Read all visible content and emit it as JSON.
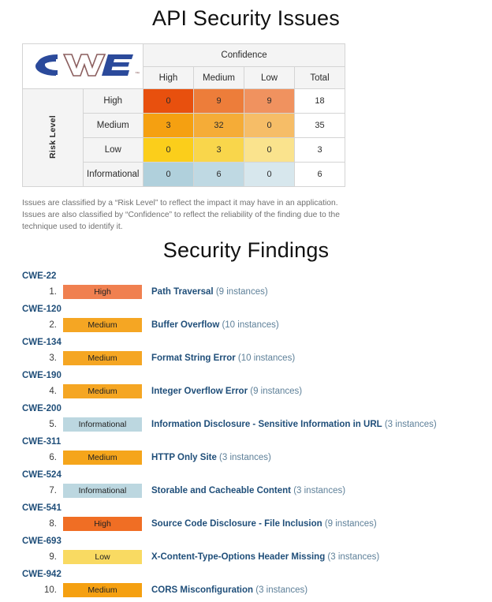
{
  "headings": {
    "api_security_issues": "API Security Issues",
    "security_findings": "Security Findings"
  },
  "logo": {
    "name": "cwe-logo",
    "text": "CWE",
    "trademark": "™",
    "blue": "#2B4A9B",
    "maroon": "#8B5E5E"
  },
  "matrix": {
    "confidence_header": "Confidence",
    "risk_level_header": "Risk Level",
    "confidence_columns": [
      "High",
      "Medium",
      "Low"
    ],
    "total_column": "Total",
    "rows": [
      {
        "risk": "High",
        "cells": [
          {
            "value": "0",
            "color": "#E8500E"
          },
          {
            "value": "9",
            "color": "#ED7D3A"
          },
          {
            "value": "9",
            "color": "#F0925F"
          }
        ],
        "total": "18"
      },
      {
        "risk": "Medium",
        "cells": [
          {
            "value": "3",
            "color": "#F5A011"
          },
          {
            "value": "32",
            "color": "#F5AC37"
          },
          {
            "value": "0",
            "color": "#F6BD67"
          }
        ],
        "total": "35"
      },
      {
        "risk": "Low",
        "cells": [
          {
            "value": "0",
            "color": "#FBCE1B"
          },
          {
            "value": "3",
            "color": "#F9D64B"
          },
          {
            "value": "0",
            "color": "#FAE38D"
          }
        ],
        "total": "3"
      },
      {
        "risk": "Informational",
        "cells": [
          {
            "value": "0",
            "color": "#B0D0DC"
          },
          {
            "value": "6",
            "color": "#BFD9E3"
          },
          {
            "value": "0",
            "color": "#D7E7ED"
          }
        ],
        "total": "6"
      }
    ]
  },
  "description": "Issues are classified by a “Risk Level” to reflect the impact it may have in an application. Issues are also classified by “Confidence” to reflect the reliability of the finding due to the technique used to identify it.",
  "findings": [
    {
      "cwe": "CWE-22",
      "number": "1.",
      "severity": "High",
      "severity_color": "#F08050",
      "name": "Path Traversal",
      "count": "(9 instances)"
    },
    {
      "cwe": "CWE-120",
      "number": "2.",
      "severity": "Medium",
      "severity_color": "#F5A623",
      "name": "Buffer Overflow",
      "count": "(10 instances)"
    },
    {
      "cwe": "CWE-134",
      "number": "3.",
      "severity": "Medium",
      "severity_color": "#F5A623",
      "name": "Format String Error",
      "count": "(10 instances)"
    },
    {
      "cwe": "CWE-190",
      "number": "4.",
      "severity": "Medium",
      "severity_color": "#F5A623",
      "name": "Integer Overflow Error",
      "count": "(9 instances)"
    },
    {
      "cwe": "CWE-200",
      "number": "5.",
      "severity": "Informational",
      "severity_color": "#BCD7E0",
      "name": "Information Disclosure - Sensitive Information in URL",
      "count": "(3 instances)"
    },
    {
      "cwe": "CWE-311",
      "number": "6.",
      "severity": "Medium",
      "severity_color": "#F5A51B",
      "name": "HTTP Only Site",
      "count": "(3 instances)"
    },
    {
      "cwe": "CWE-524",
      "number": "7.",
      "severity": "Informational",
      "severity_color": "#BCD7E0",
      "name": "Storable and Cacheable Content",
      "count": "(3 instances)"
    },
    {
      "cwe": "CWE-541",
      "number": "8.",
      "severity": "High",
      "severity_color": "#F06E24",
      "name": "Source Code Disclosure - File Inclusion",
      "count": "(9 instances)"
    },
    {
      "cwe": "CWE-693",
      "number": "9.",
      "severity": "Low",
      "severity_color": "#F9DA62",
      "name": "X-Content-Type-Options Header Missing",
      "count": "(3 instances)"
    },
    {
      "cwe": "CWE-942",
      "number": "10.",
      "severity": "Medium",
      "severity_color": "#F5A011",
      "name": "CORS Misconfiguration",
      "count": "(3 instances)"
    }
  ]
}
